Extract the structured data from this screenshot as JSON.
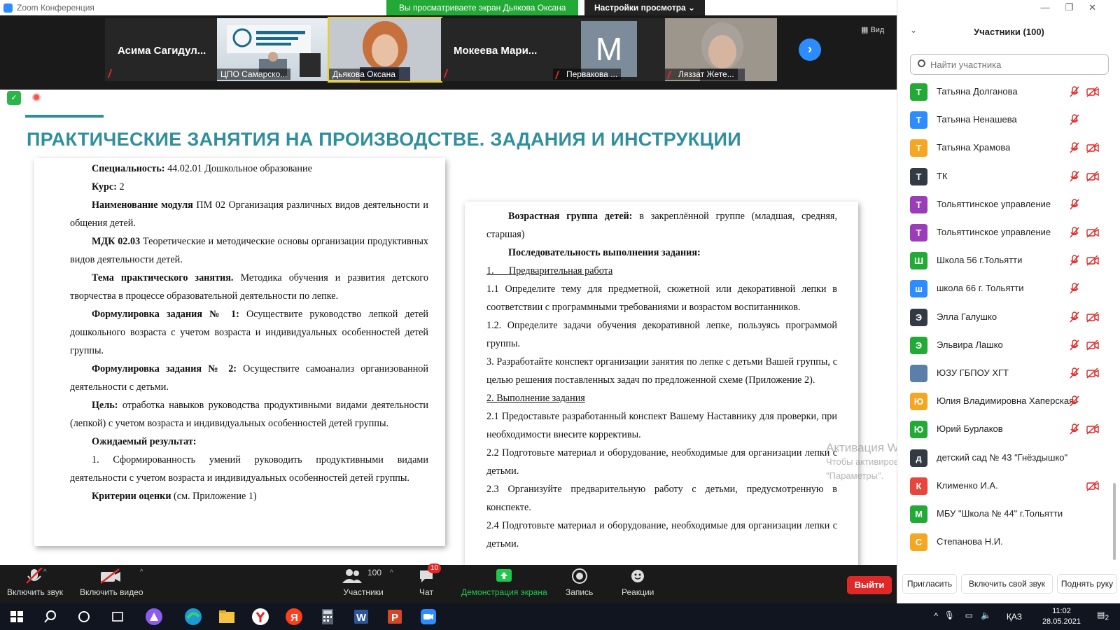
{
  "window": {
    "title": "Zoom Конференция",
    "share_banner": "Вы просматриваете экран Дьякова Оксана",
    "view_settings": "Настройки просмотра ⌄",
    "view_button": "Вид"
  },
  "video_strip": [
    {
      "type": "name",
      "label": "Асима  Сагидул...",
      "muted": true
    },
    {
      "type": "image",
      "label": "ЦПО Самарско...",
      "muted": false
    },
    {
      "type": "image",
      "label": "Дьякова Оксана",
      "muted": false
    },
    {
      "type": "name",
      "label": "Мокеева  Мари...",
      "muted": true
    },
    {
      "type": "avatar",
      "letter": "M",
      "label": "Первакова ...",
      "muted": true
    },
    {
      "type": "image",
      "label": "Ляззат Жете...",
      "muted": true
    }
  ],
  "slide": {
    "title": "ПРАКТИЧЕСКИЕ ЗАНЯТИЯ НА ПРОИЗВОДСТВЕ. ЗАДАНИЯ И ИНСТРУКЦИИ",
    "left": {
      "spec_label": "Специальность:",
      "spec": " 44.02.01 Дошкольное образование",
      "course_label": "Курс:",
      "course": " 2",
      "module_label": "Наименование модуля",
      "module": " ПМ 02 Организация различных видов деятельности и общения детей.",
      "mdk_label": "МДК 02.03",
      "mdk": " Теоретические и методические  основы организации продуктивных видов деятельности детей.",
      "topic_label": "Тема практического занятия.",
      "topic": " Методика обучения и развития детского творчества в процессе образовательной деятельности по лепке.",
      "task1_label": "Формулировка задания № 1:",
      "task1": " Осуществите руководство лепкой детей дошкольного возраста с учетом возраста и индивидуальных особенностей детей группы.",
      "task2_label": "Формулировка задания № 2:",
      "task2": "  Осуществите самоанализ организованной деятельности с детьми.",
      "goal_label": "Цель:",
      "goal": " отработка навыков руководства продуктивными видами деятельности (лепкой) с учетом возраста и индивидуальных особенностей детей группы.",
      "result_label": "Ожидаемый результат:",
      "result1": "1. Сформированность умений руководить продуктивными видами деятельности с учетом возраста и индивидуальных особенностей детей группы.",
      "criteria_label": "Критерии оценки",
      "criteria": " (см. Приложение 1)"
    },
    "right": {
      "age_label": "Возрастная группа детей:",
      "age": " в закреплённой группе (младшая, средняя, старшая)",
      "seq_label": "Последовательность выполнения задания:",
      "s1": "1.      Предварительная работа",
      "s11": "1.1     Определите тему для предметной, сюжетной или декоративной лепки в соответствии с программными требованиями и возрастом воспитанников.",
      "s12": "1.2. Определите задачи обучения декоративной лепке, пользуясь программой группы.",
      "s3": "3.      Разработайте конспект организации занятия по лепке с детьми Вашей группы, с целью решения поставленных задач по предложенной схеме (Приложение 2).",
      "s2": "2. Выполнение задания",
      "s21": "2.1     Предоставьте разработанный конспект Вашему Наставнику для проверки, при необходимости внесите коррективы.",
      "s22": "2.2 Подготовьте материал и оборудование, необходимые для организации лепки с детьми.",
      "s23": "2.3 Организуйте предварительную работу с детьми, предусмотренную в конспекте.",
      "s24": "2.4 Подготовьте материал и оборудование, необходимые для организации лепки с детьми."
    }
  },
  "watermark": {
    "line1": "Активация Windows",
    "line2": "Чтобы активировать Windows, перейдите в раздел",
    "line3": "\"Параметры\"."
  },
  "participants": {
    "title": "Участники (100)",
    "search_placeholder": "Найти участника",
    "list": [
      {
        "letter": "Т",
        "color": "#23a936",
        "name": "Татьяна Долганова",
        "mic_off": true,
        "cam_off": true
      },
      {
        "letter": "Т",
        "color": "#2d8cff",
        "name": "Татьяна Ненашева",
        "mic_off": true,
        "cam_off": false
      },
      {
        "letter": "Т",
        "color": "#f5a623",
        "name": "Татьяна Храмова",
        "mic_off": true,
        "cam_off": true
      },
      {
        "letter": "Т",
        "color": "#333a44",
        "name": "ТК",
        "mic_off": true,
        "cam_off": true
      },
      {
        "letter": "Т",
        "color": "#9b3db8",
        "name": "Тольяттинское управление",
        "mic_off": true,
        "cam_off": false
      },
      {
        "letter": "Т",
        "color": "#9b3db8",
        "name": "Тольяттинское управление",
        "mic_off": true,
        "cam_off": true
      },
      {
        "letter": "Ш",
        "color": "#23a936",
        "name": "Школа 56 г.Тольятти",
        "mic_off": true,
        "cam_off": true
      },
      {
        "letter": "ш",
        "color": "#2d8cff",
        "name": "школа 66 г. Тольятти",
        "mic_off": true,
        "cam_off": false
      },
      {
        "letter": "Э",
        "color": "#333a44",
        "name": "Элла Галушко",
        "mic_off": true,
        "cam_off": true
      },
      {
        "letter": "Э",
        "color": "#23a936",
        "name": "Эльвира Лашко",
        "mic_off": true,
        "cam_off": true
      },
      {
        "letter": "",
        "color": "#5a7fa8",
        "name": "ЮЗУ ГБПОУ ХГТ",
        "mic_off": true,
        "cam_off": true
      },
      {
        "letter": "Ю",
        "color": "#f5a623",
        "name": "Юлия Владимировна Хаперская",
        "mic_off": true,
        "cam_off": false
      },
      {
        "letter": "Ю",
        "color": "#23a936",
        "name": "Юрий Бурлаков",
        "mic_off": true,
        "cam_off": true
      },
      {
        "letter": "д",
        "color": "#333a44",
        "name": "детский сад № 43 \"Гнёздышко\"",
        "mic_off": false,
        "cam_off": false
      },
      {
        "letter": "К",
        "color": "#e8453c",
        "name": "Клименко И.А.",
        "mic_off": false,
        "cam_off": true
      },
      {
        "letter": "М",
        "color": "#23a936",
        "name": "МБУ \"Школа № 44\" г.Тольятти",
        "mic_off": false,
        "cam_off": false
      },
      {
        "letter": "С",
        "color": "#f5a623",
        "name": "Степанова Н.И.",
        "mic_off": false,
        "cam_off": false
      }
    ],
    "invite": "Пригласить",
    "unmute": "Включить свой звук",
    "raise_hand": "Поднять руку"
  },
  "toolbar": {
    "audio": "Включить звук",
    "video": "Включить видео",
    "participants_count": "100",
    "participants": "Участники",
    "chat_badge": "10",
    "chat": "Чат",
    "share": "Демонстрация экрана",
    "record": "Запись",
    "reactions": "Реакции",
    "leave": "Выйти"
  },
  "taskbar": {
    "lang": "ҚАЗ",
    "time": "11:02",
    "date": "28.05.2021",
    "notif_count": "2"
  },
  "colors": {
    "accent": "#2f8f9d",
    "zoom_blue": "#2d8cff",
    "share_green": "#23a936",
    "muted_red": "#e02828"
  }
}
